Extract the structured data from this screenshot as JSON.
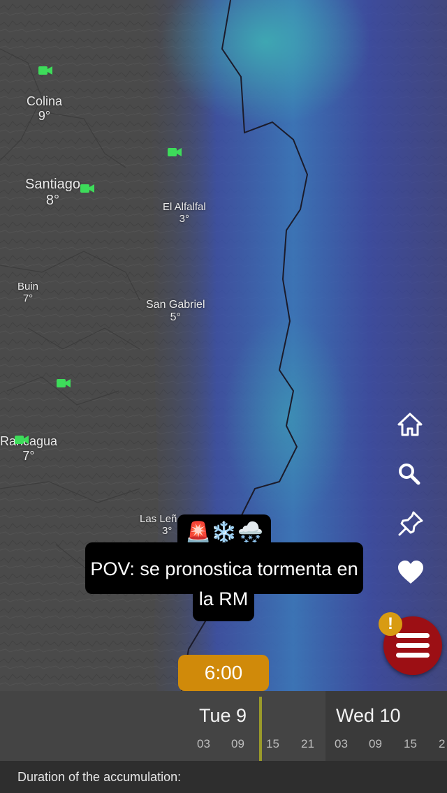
{
  "map": {
    "cities": [
      {
        "name": "Colina",
        "temp": "9°"
      },
      {
        "name": "Santiago",
        "temp": "8°"
      },
      {
        "name": "El Alfalfal",
        "temp": "3°"
      },
      {
        "name": "Buin",
        "temp": "7°"
      },
      {
        "name": "San Gabriel",
        "temp": "5°"
      },
      {
        "name": "Rancagua",
        "temp": "7°"
      },
      {
        "name": "Las Leñ",
        "temp": "3°"
      }
    ],
    "colors": {
      "base": "#4a4a4a",
      "precip_blue": "#3a5fc4",
      "precip_cyan": "#3aa8b8",
      "border": "#1b1b2a",
      "camera": "#3ddc5a"
    }
  },
  "caption": {
    "emoji": "🚨❄️🌨️",
    "line1": "POV: se pronostica tormenta en",
    "line2": "la RM"
  },
  "controls": {
    "home_icon": "home-icon",
    "search_icon": "search-icon",
    "pin_icon": "pin-icon",
    "favorite_icon": "heart-icon",
    "menu_icon": "hamburger-menu-icon",
    "alert_badge": "!",
    "accent": "#9c0f14",
    "badge_color": "#d89b12"
  },
  "timeline": {
    "current_time": "6:00",
    "days": [
      {
        "label": "Tue 9",
        "hours": [
          "03",
          "09",
          "15",
          "21"
        ]
      },
      {
        "label": "Wed 10",
        "hours": [
          "03",
          "09",
          "15",
          "2"
        ]
      }
    ],
    "bubble_color": "#d08a0a"
  },
  "footer": {
    "label": "Duration of the accumulation:"
  }
}
